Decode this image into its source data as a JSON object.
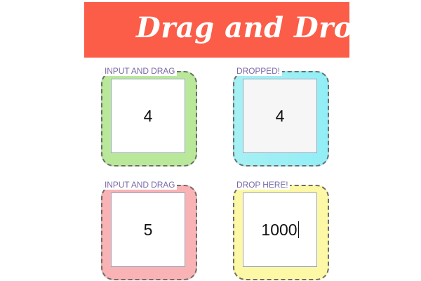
{
  "header": {
    "title": "Drag and Drop",
    "background_color": "#fb5d48"
  },
  "cells": [
    {
      "label": "INPUT AND DRAG",
      "value": "4",
      "role": "input",
      "color": "#b9e89a"
    },
    {
      "label": "DROPPED!",
      "value": "4",
      "role": "dropzone",
      "color": "#92eef6"
    },
    {
      "label": "INPUT AND DRAG",
      "value": "5",
      "role": "input",
      "color": "#f9b3b5"
    },
    {
      "label": "DROP HERE!",
      "value": "1000",
      "role": "dropzone",
      "color": "#fdf8a5"
    }
  ]
}
